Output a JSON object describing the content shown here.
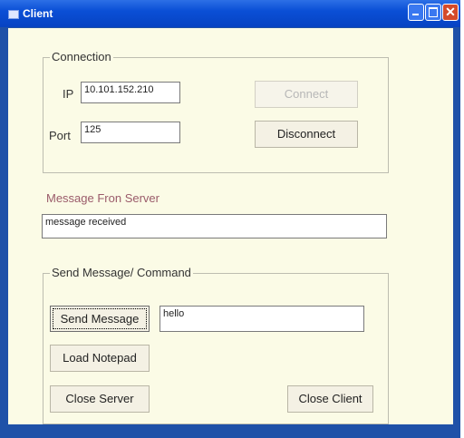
{
  "window": {
    "title": "Client"
  },
  "connection": {
    "group_label": "Connection",
    "ip_label": "IP",
    "ip_value": "10.101.152.210",
    "port_label": "Port",
    "port_value": "125",
    "connect_label": "Connect",
    "disconnect_label": "Disconnect"
  },
  "server_message": {
    "heading": "Message Fron Server",
    "value": "message received"
  },
  "send": {
    "group_label": "Send Message/ Command",
    "send_label": "Send Message",
    "message_value": "hello",
    "notepad_label": "Load Notepad",
    "close_server_label": "Close Server",
    "close_client_label": "Close Client"
  },
  "icons": {
    "app": "window-app-icon",
    "minimize": "minimize-icon",
    "maximize": "maximize-icon",
    "close": "close-icon"
  },
  "colors": {
    "titlebar": "#0a4fd6",
    "client_bg": "#fbfbe6",
    "heading_text": "#9a5b6a",
    "close_button": "#d44a2a"
  }
}
